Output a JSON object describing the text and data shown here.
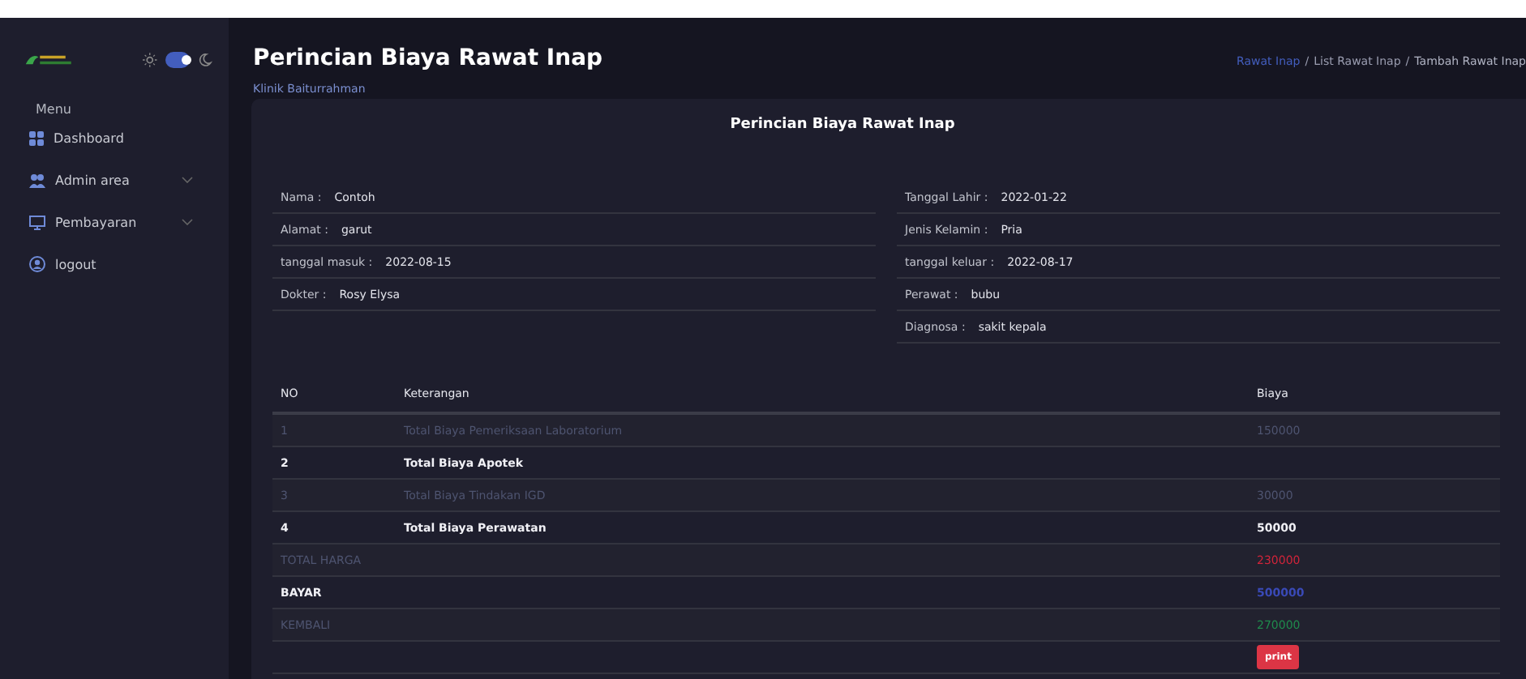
{
  "sidebar": {
    "theme_toggle": {
      "on": true
    },
    "menu_label": "Menu",
    "items": [
      {
        "label": "Dashboard",
        "kind": "grid",
        "has_caret": false
      },
      {
        "label": "Admin area",
        "kind": "users",
        "has_caret": true
      },
      {
        "label": "Pembayaran",
        "kind": "monitor",
        "has_caret": true
      },
      {
        "label": "logout",
        "kind": "user",
        "has_caret": false
      }
    ]
  },
  "header": {
    "title": "Perincian Biaya Rawat Inap",
    "subtitle": "Klinik Baiturrahman",
    "breadcrumb": [
      {
        "label": "Rawat Inap",
        "selected": false
      },
      {
        "label": "List Rawat Inap",
        "selected": false
      },
      {
        "label": "Tambah Rawat Inap",
        "selected": true
      }
    ],
    "separator": "/"
  },
  "card": {
    "title": "Perincian Biaya Rawat Inap",
    "info_left": [
      {
        "label": "Nama :",
        "value": "Contoh"
      },
      {
        "label": "Alamat :",
        "value": "garut"
      },
      {
        "label": "tanggal masuk :",
        "value": "2022-08-15"
      },
      {
        "label": "Dokter :",
        "value": "Rosy Elysa"
      }
    ],
    "info_right": [
      {
        "label": "Tanggal Lahir :",
        "value": "2022-01-22"
      },
      {
        "label": "Jenis Kelamin :",
        "value": "Pria"
      },
      {
        "label": "tanggal keluar :",
        "value": "2022-08-17"
      },
      {
        "label": "Perawat :",
        "value": "bubu"
      },
      {
        "label": "Diagnosa :",
        "value": "sakit kepala"
      }
    ],
    "table": {
      "columns": [
        "NO",
        "Keterangan",
        "Biaya"
      ],
      "rows": [
        {
          "no": "1",
          "keterangan": "Total Biaya Pemeriksaan Laboratorium",
          "biaya": "150000",
          "muted": true
        },
        {
          "no": "2",
          "keterangan": "Total Biaya Apotek",
          "muted": false
        },
        {
          "no": "3",
          "keterangan": "Total Biaya Tindakan IGD",
          "biaya": "30000",
          "muted": true
        },
        {
          "no": "4",
          "keterangan": "Total Biaya Perawatan",
          "biaya": "50000",
          "muted": false
        }
      ],
      "summary": [
        {
          "label": "TOTAL HARGA",
          "value": "230000",
          "muted": true,
          "color": "#d0243a"
        },
        {
          "label": "BAYAR",
          "value": "500000",
          "muted": false,
          "color": "#3a4ab8"
        },
        {
          "label": "KEMBALI",
          "value": "270000",
          "muted": true,
          "color": "#1f8a4c"
        }
      ]
    },
    "print_button": "print"
  }
}
